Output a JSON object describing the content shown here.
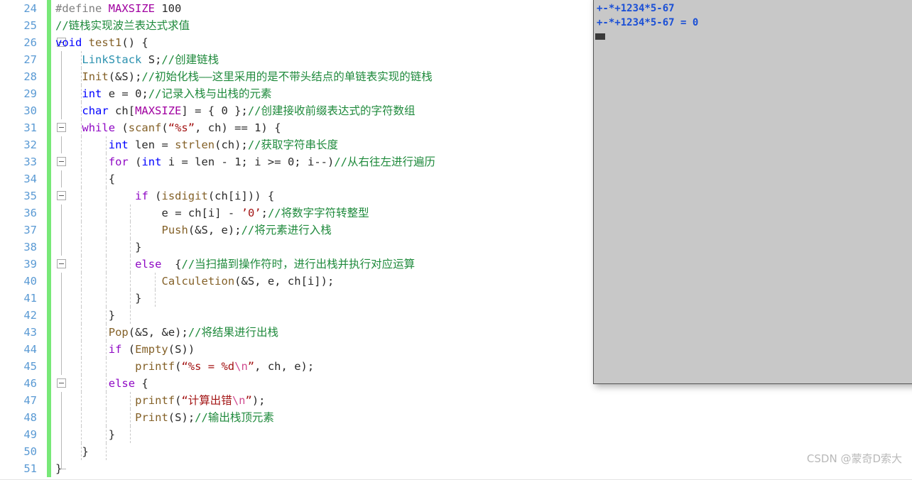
{
  "editor": {
    "language": "C",
    "first_line": 24,
    "last_line": 51,
    "accent_change_bar_color": "#78e878",
    "line_number_color": "#5a9ad4",
    "background": "#ffffff",
    "lines": [
      {
        "num": "24",
        "text": "#define MAXSIZE 100"
      },
      {
        "num": "25",
        "text": "//链栈实现波兰表达式求值"
      },
      {
        "num": "26",
        "text": "void test1() {"
      },
      {
        "num": "27",
        "text": "    LinkStack S;//创建链栈"
      },
      {
        "num": "28",
        "text": "    Init(&S);//初始化栈——这里采用的是不带头结点的单链表实现的链栈"
      },
      {
        "num": "29",
        "text": "    int e = 0;//记录入栈与出栈的元素"
      },
      {
        "num": "30",
        "text": "    char ch[MAXSIZE] = { 0 };//创建接收前缀表达式的字符数组"
      },
      {
        "num": "31",
        "text": "    while (scanf(“%s”, ch) == 1) {"
      },
      {
        "num": "32",
        "text": "        int len = strlen(ch);//获取字符串长度"
      },
      {
        "num": "33",
        "text": "        for (int i = len - 1; i >= 0; i--)//从右往左进行遍历"
      },
      {
        "num": "34",
        "text": "        {"
      },
      {
        "num": "35",
        "text": "            if (isdigit(ch[i])) {"
      },
      {
        "num": "36",
        "text": "                e = ch[i] - ’0’;//将数字字符转整型"
      },
      {
        "num": "37",
        "text": "                Push(&S, e);//将元素进行入栈"
      },
      {
        "num": "38",
        "text": "            }"
      },
      {
        "num": "39",
        "text": "            else  {//当扫描到操作符时，进行出栈并执行对应运算"
      },
      {
        "num": "40",
        "text": "                Calculetion(&S, e, ch[i]);"
      },
      {
        "num": "41",
        "text": "            }"
      },
      {
        "num": "42",
        "text": "        }"
      },
      {
        "num": "43",
        "text": "        Pop(&S, &e);//将结果进行出栈"
      },
      {
        "num": "44",
        "text": "        if (Empty(S))"
      },
      {
        "num": "45",
        "text": "            printf(“%s = %d\\n”, ch, e);"
      },
      {
        "num": "46",
        "text": "        else {"
      },
      {
        "num": "47",
        "text": "            printf(“计算出错\\n”);"
      },
      {
        "num": "48",
        "text": "            Print(S);//输出栈顶元素"
      },
      {
        "num": "49",
        "text": "        }"
      },
      {
        "num": "50",
        "text": "    }"
      },
      {
        "num": "51",
        "text": "}"
      }
    ]
  },
  "console": {
    "title": "program-output-window",
    "background": "#c8c8c8",
    "text_color": "#1a4fd6",
    "lines": [
      "+-*+1234*5-67",
      "+-*+1234*5-67 = 0"
    ],
    "cursor": "block-caret"
  },
  "watermark": {
    "text": "CSDN @蒙奇D索大"
  }
}
